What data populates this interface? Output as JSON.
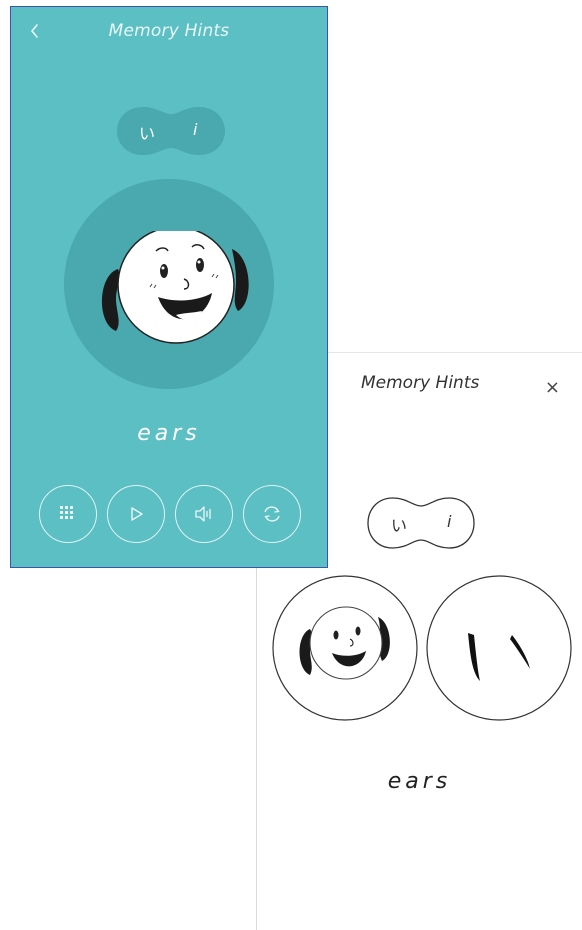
{
  "teal_screen": {
    "title": "Memory Hints",
    "pill": {
      "kana": "い",
      "romaji": "i"
    },
    "word": "ears",
    "icons": {
      "back": "chevron-left-icon",
      "grid": "grid-icon",
      "play": "play-icon",
      "audio": "speaker-icon",
      "refresh": "refresh-icon"
    },
    "colors": {
      "background": "#5bbfc3",
      "circle": "#49a9ae",
      "border": "#3b55a8"
    }
  },
  "white_panel": {
    "title": "Memory Hints",
    "close_label": "×",
    "pill": {
      "kana": "い",
      "romaji": "i"
    },
    "word": "ears"
  }
}
